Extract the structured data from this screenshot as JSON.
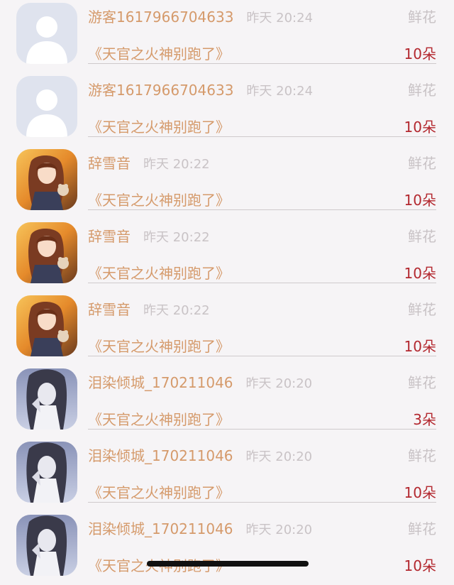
{
  "rows": [
    {
      "avatar": "guest-avatar-icon",
      "name": "游客1617966704633",
      "time": "昨天 20:24",
      "gift": "鲜花",
      "book": "《天官之火神别跑了》",
      "amount": "10朵"
    },
    {
      "avatar": "guest-avatar-icon",
      "name": "游客1617966704633",
      "time": "昨天 20:24",
      "gift": "鲜花",
      "book": "《天官之火神别跑了》",
      "amount": "10朵"
    },
    {
      "avatar": "anime-girl-avatar",
      "name": "辞雪音",
      "time": "昨天 20:22",
      "gift": "鲜花",
      "book": "《天官之火神别跑了》",
      "amount": "10朵"
    },
    {
      "avatar": "anime-girl-avatar",
      "name": "辞雪音",
      "time": "昨天 20:22",
      "gift": "鲜花",
      "book": "《天官之火神别跑了》",
      "amount": "10朵"
    },
    {
      "avatar": "anime-girl-avatar",
      "name": "辞雪音",
      "time": "昨天 20:22",
      "gift": "鲜花",
      "book": "《天官之火神别跑了》",
      "amount": "10朵"
    },
    {
      "avatar": "sketch-girl-avatar",
      "name": "泪染倾城_170211046",
      "time": "昨天 20:20",
      "gift": "鲜花",
      "book": "《天官之火神别跑了》",
      "amount": "3朵"
    },
    {
      "avatar": "sketch-girl-avatar",
      "name": "泪染倾城_170211046",
      "time": "昨天 20:20",
      "gift": "鲜花",
      "book": "《天官之火神别跑了》",
      "amount": "10朵"
    },
    {
      "avatar": "sketch-girl-avatar",
      "name": "泪染倾城_170211046",
      "time": "昨天 20:20",
      "gift": "鲜花",
      "book": "《天官之火神别跑了》",
      "amount": "10朵"
    }
  ],
  "colors": {
    "name": "#d59a6b",
    "time": "#c9c3c6",
    "amount": "#b3282f",
    "background": "#f6f4f6"
  }
}
